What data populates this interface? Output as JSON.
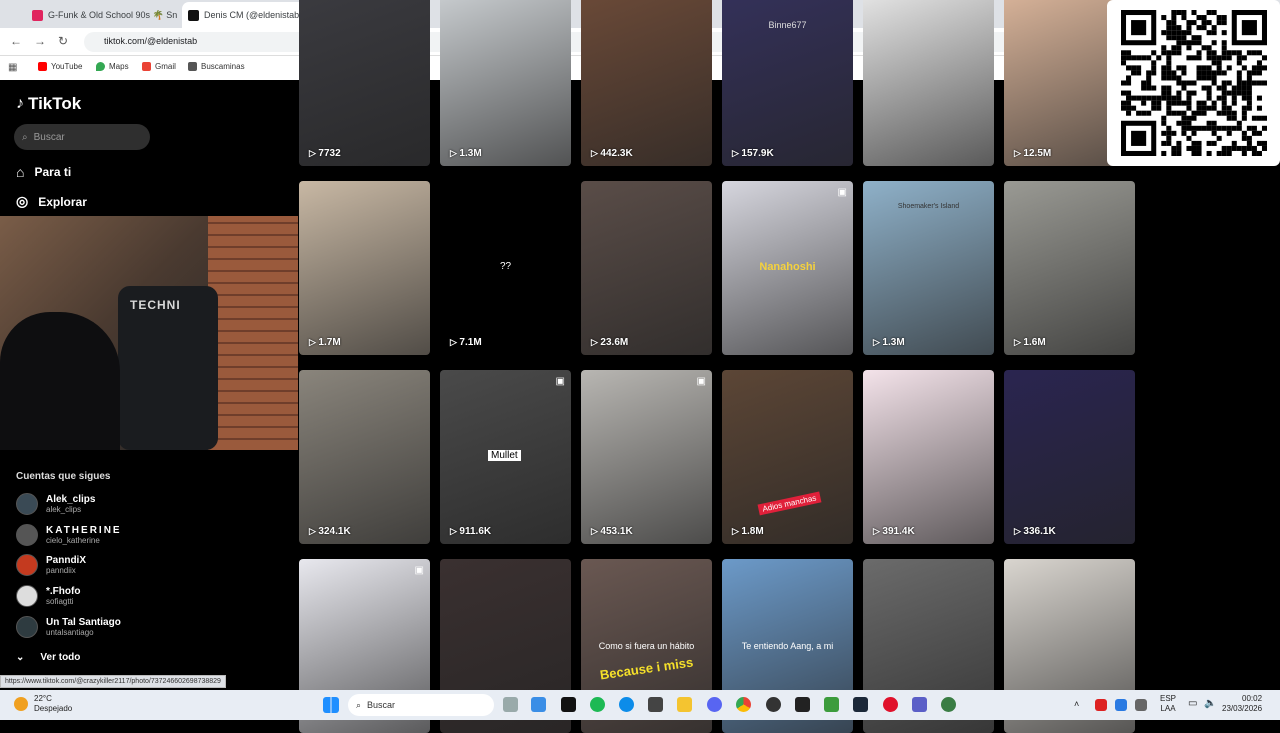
{
  "browser": {
    "tabs": [
      {
        "title": "G-Funk & Old School 90s 🌴 Sn",
        "favicon_color": "#e0245e"
      },
      {
        "title": "Denis CM (@eldenistab",
        "favicon_color": "#000000"
      }
    ],
    "url": "tiktok.com/@eldenistab",
    "bookmarks": [
      {
        "label": "YouTube",
        "color": "#ff0000"
      },
      {
        "label": "Maps",
        "color": "#34a853"
      },
      {
        "label": "Gmail",
        "color": "#ea4335"
      },
      {
        "label": "Buscaminas",
        "color": "#555555"
      }
    ],
    "status_url": "https://www.tiktok.com/@crazykiller2117/photo/737246602698738829"
  },
  "sidebar": {
    "logo": "TikTok",
    "search_placeholder": "Buscar",
    "nav": [
      {
        "label": "Para ti",
        "icon": "home-icon"
      },
      {
        "label": "Explorar",
        "icon": "compass-icon"
      }
    ],
    "webcam_text": "TECHNI",
    "following_header": "Cuentas que sigues",
    "accounts": [
      {
        "name": "Alek_clips",
        "handle": "alek_clips"
      },
      {
        "name": "KATHERINE",
        "handle": "cielo_katherine"
      },
      {
        "name": "PanndiX",
        "handle": "panndiix"
      },
      {
        "name": "*.Fhofo",
        "handle": "sofiagtti"
      },
      {
        "name": "Un Tal Santiago",
        "handle": "untalsantiago"
      }
    ],
    "see_all": "Ver todo"
  },
  "grid": {
    "rows": [
      [
        {
          "views": "7732",
          "color": "#3b3b40",
          "overlay": ""
        },
        {
          "views": "1.3M",
          "color": "#c9cdd0",
          "overlay": ""
        },
        {
          "views": "442.3K",
          "color": "#6b4a38",
          "overlay": ""
        },
        {
          "views": "157.9K",
          "color": "#34315a",
          "overlay": "Binne677"
        },
        {
          "views": "",
          "color": "#e6e6e6",
          "overlay": ""
        },
        {
          "views": "12.5M",
          "color": "#d9b49a",
          "overlay": ""
        }
      ],
      [
        {
          "views": "1.7M",
          "color": "#c8b8a4",
          "overlay": ""
        },
        {
          "views": "7.1M",
          "color": "#000000",
          "overlay": "??"
        },
        {
          "views": "23.6M",
          "color": "#5a4d48",
          "overlay": ""
        },
        {
          "views": "",
          "color": "#d6d6de",
          "overlay": "Nanahoshi"
        },
        {
          "views": "1.3M",
          "color": "#8fb1c9",
          "overlay": "Shoemaker's Island"
        },
        {
          "views": "1.6M",
          "color": "#9a9a94",
          "overlay": ""
        }
      ],
      [
        {
          "views": "324.1K",
          "color": "#8a857c",
          "overlay": ""
        },
        {
          "views": "911.6K",
          "color": "#4a4a4a",
          "overlay": "Mullet"
        },
        {
          "views": "453.1K",
          "color": "#b8b6b2",
          "overlay": ""
        },
        {
          "views": "1.8M",
          "color": "#5c4636",
          "overlay": "Adios manchas"
        },
        {
          "views": "391.4K",
          "color": "#f4e3ea",
          "overlay": ""
        },
        {
          "views": "336.1K",
          "color": "#2a2550",
          "overlay": ""
        }
      ],
      [
        {
          "views": "",
          "color": "#e8e8ee",
          "overlay": ""
        },
        {
          "views": "",
          "color": "#3a3030",
          "overlay": ""
        },
        {
          "views": "",
          "color": "#6a5852",
          "overlay": "Como si fuera un hábito"
        },
        {
          "views": "",
          "color": "#6c9ac9",
          "overlay": "Te entiendo Aang, a mi"
        },
        {
          "views": "",
          "color": "#6b6b6b",
          "overlay": ""
        },
        {
          "views": "",
          "color": "#d9d5cf",
          "overlay": ""
        }
      ]
    ],
    "caption_because": "Because i miss"
  },
  "taskbar": {
    "temp": "22°C",
    "weather": "Despejado",
    "search": "Buscar",
    "lang_top": "ESP",
    "lang_bottom": "LAA",
    "time": "00:02",
    "date": "23/03/2026"
  }
}
